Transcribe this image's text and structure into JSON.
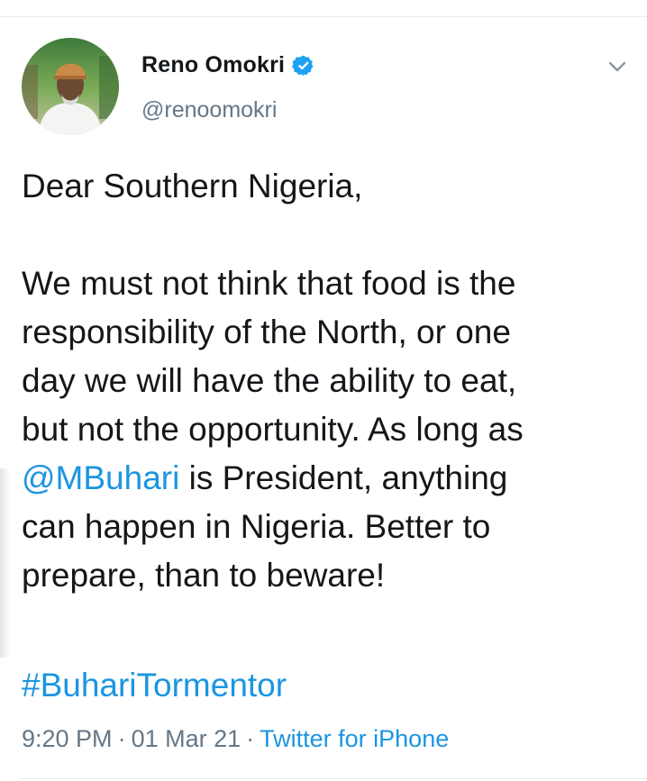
{
  "author": {
    "name": "Reno Omokri",
    "handle": "@renoomokri",
    "verified": true
  },
  "tweet": {
    "greeting": "Dear Southern Nigeria,",
    "line1": "We must not think that food is the",
    "line2": "responsibility of the North, or one",
    "line3": "day we will have the ability to eat,",
    "line4": "but not the opportunity. As long as",
    "mention": "@MBuhari",
    "line5_rest": " is President, anything",
    "line6": "can happen in Nigeria. Better to",
    "line7": "prepare, than to beware!",
    "hashtag": "#BuhariTormentor"
  },
  "meta": {
    "time": "9:20 PM",
    "separator": "·",
    "date": "01 Mar 21",
    "source": "Twitter for iPhone"
  },
  "colors": {
    "link": "#1b95e0",
    "text": "#14171a",
    "muted": "#657786",
    "verified_badge": "#1da1f2"
  },
  "icons": {
    "verified": "verified-badge-icon",
    "menu": "chevron-down-icon"
  }
}
